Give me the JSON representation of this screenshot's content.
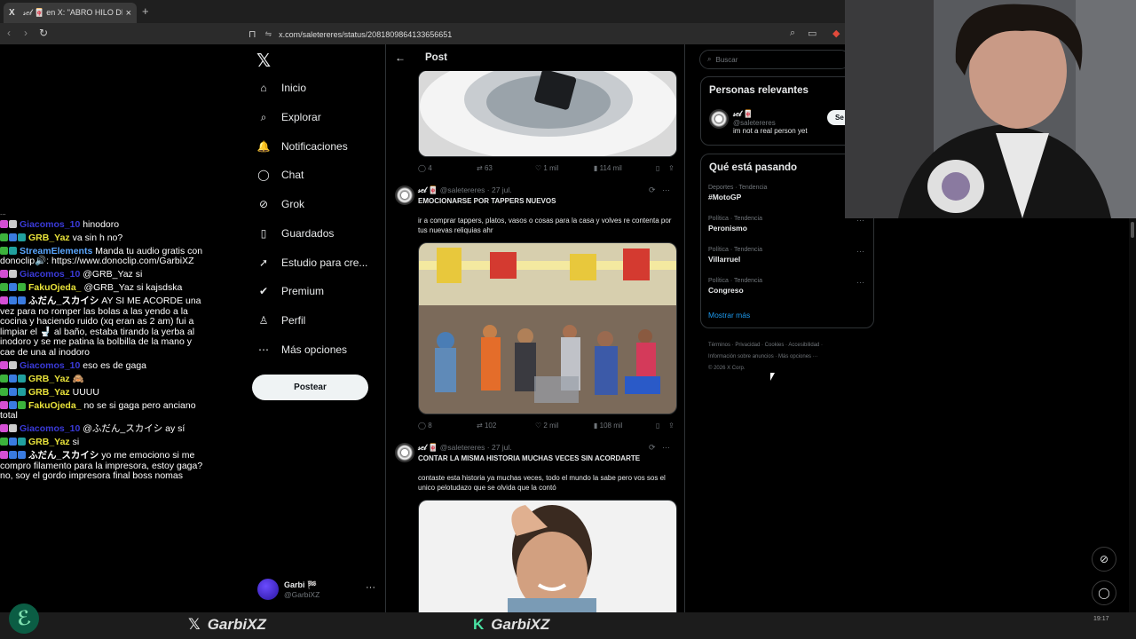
{
  "browser": {
    "tab_title": "𝓈𝑒𝓁 🀄 en X: \"ABRO HILO DE TO",
    "tab_close": "×",
    "new_tab": "+",
    "url": "x.com/saletereres/status/2081809864133656651"
  },
  "chat": {
    "top_fragment": "...",
    "messages": [
      {
        "badges": [
          "pink",
          "grey"
        ],
        "user": "Giacomos_10",
        "user_color": "#3a3ad8",
        "text": "hinodoro"
      },
      {
        "badges": [
          "green",
          "blue",
          "teal"
        ],
        "user": "GRB_Yaz",
        "user_color": "#e8e23a",
        "text": "va sin h no?"
      },
      {
        "badges": [
          "green",
          "teal"
        ],
        "user": "StreamElements",
        "user_color": "#5aa7ff",
        "text": "Manda tu audio gratis con donoclip🔊: https://www.donoclip.com/GarbiXZ"
      },
      {
        "badges": [
          "pink",
          "grey"
        ],
        "user": "Giacomos_10",
        "user_color": "#3a3ad8",
        "text": "@GRB_Yaz si"
      },
      {
        "badges": [
          "green",
          "blue",
          "green"
        ],
        "user": "FakuOjeda_",
        "user_color": "#e8e23a",
        "text": "@GRB_Yaz si kajsdska"
      },
      {
        "badges": [
          "pink",
          "blue",
          "blue"
        ],
        "user": "ふだん_スカイシ",
        "user_color": "#ffffff",
        "text": "AY SI ME ACORDE una vez para no romper las bolas a las yendo a la cocina y haciendo ruido (xq eran as 2 am) fui a limpiar el 🚽 al baño, estaba tirando la yerba al inodoro y se me patina la bolbilla de la mano y cae de una al inodoro"
      },
      {
        "badges": [
          "pink",
          "grey"
        ],
        "user": "Giacomos_10",
        "user_color": "#3a3ad8",
        "text": "eso es de gaga"
      },
      {
        "badges": [
          "green",
          "blue",
          "teal"
        ],
        "user": "GRB_Yaz",
        "user_color": "#e8e23a",
        "text": "🙈"
      },
      {
        "badges": [
          "green",
          "blue",
          "teal"
        ],
        "user": "GRB_Yaz",
        "user_color": "#e8e23a",
        "text": "UUUU"
      },
      {
        "badges": [
          "pink",
          "blue",
          "green"
        ],
        "user": "FakuOjeda_",
        "user_color": "#e8e23a",
        "text": "no se si gaga pero anciano total"
      },
      {
        "badges": [
          "pink",
          "grey"
        ],
        "user": "Giacomos_10",
        "user_color": "#3a3ad8",
        "text": "@ふだん_スカイシ ay sí"
      },
      {
        "badges": [
          "green",
          "blue",
          "teal"
        ],
        "user": "GRB_Yaz",
        "user_color": "#e8e23a",
        "text": "si"
      },
      {
        "badges": [
          "pink",
          "blue",
          "blue"
        ],
        "user": "ふだん_スカイシ",
        "user_color": "#ffffff",
        "text": "yo me emociono si me compro filamento para la impresora, estoy gaga? no, soy el gordo impresora final boss nomas"
      }
    ]
  },
  "x_nav": {
    "logo": "𝕏",
    "items": [
      {
        "label": "Inicio",
        "icon": "home-icon",
        "glyph": "⌂"
      },
      {
        "label": "Explorar",
        "icon": "search-icon",
        "glyph": "⌕"
      },
      {
        "label": "Notificaciones",
        "icon": "bell-icon",
        "glyph": "🔔"
      },
      {
        "label": "Chat",
        "icon": "chat-icon",
        "glyph": "◯"
      },
      {
        "label": "Grok",
        "icon": "grok-icon",
        "glyph": "⊘"
      },
      {
        "label": "Guardados",
        "icon": "bookmark-icon",
        "glyph": "▯"
      },
      {
        "label": "Estudio para cre...",
        "icon": "rocket-icon",
        "glyph": "➚"
      },
      {
        "label": "Premium",
        "icon": "verified-icon",
        "glyph": "✔"
      },
      {
        "label": "Perfil",
        "icon": "person-icon",
        "glyph": "♙"
      },
      {
        "label": "Más opciones",
        "icon": "more-icon",
        "glyph": "⋯"
      }
    ],
    "post_button": "Postear",
    "account_name": "Garbi 🏁",
    "account_handle": "@GarbiXZ",
    "account_more": "···"
  },
  "feed": {
    "header_title": "Post",
    "back_glyph": "←",
    "tweet1_actions": {
      "replies": "4",
      "reposts": "63",
      "likes": "1 mil",
      "views": "114 mil"
    },
    "tweet2": {
      "name": "𝓈𝑒𝓁 🀄",
      "handle": "@saletereres · 27 jul.",
      "headline": "EMOCIONARSE POR TAPPERS NUEVOS",
      "body": "ir a comprar tappers, platos, vasos o cosas para la casa y volves re contenta por tus nuevas reliquias ahr",
      "actions": {
        "replies": "8",
        "reposts": "102",
        "likes": "2 mil",
        "views": "108 mil"
      }
    },
    "tweet3": {
      "name": "𝓈𝑒𝓁 🀄",
      "handle": "@saletereres · 27 jul.",
      "headline": "CONTAR LA MISMA HISTORIA MUCHAS VECES SIN ACORDARTE",
      "body": "contaste esta historia ya muchas veces, todo el mundo la sabe pero vos sos el unico pelotudazo que se olvida que la contó"
    }
  },
  "sidebar": {
    "search_placeholder": "Buscar",
    "relevant_title": "Personas relevantes",
    "relevant_name": "𝓈𝑒𝓁 🀄",
    "relevant_handle": "@saletereres",
    "relevant_bio": "im not a real person yet",
    "follow_label": "Se",
    "trending_title": "Qué está pasando",
    "trends": [
      {
        "context": "Deportes · Tendencia",
        "name": "#MotoGP"
      },
      {
        "context": "Política · Tendencia",
        "name": "Peronismo"
      },
      {
        "context": "Política · Tendencia",
        "name": "Villarruel"
      },
      {
        "context": "Política · Tendencia",
        "name": "Congreso"
      }
    ],
    "show_more": "Mostrar más",
    "footer_line1": "Términos · Privacidad · Cookies · Accesibilidad ·",
    "footer_line2": "Información sobre anuncios · Más opciones ···",
    "footer_line3": "© 2026 X Corp."
  },
  "overlay": {
    "social1_name": "GarbiXZ",
    "social2_name": "GarbiXZ",
    "clock": "19:17"
  }
}
